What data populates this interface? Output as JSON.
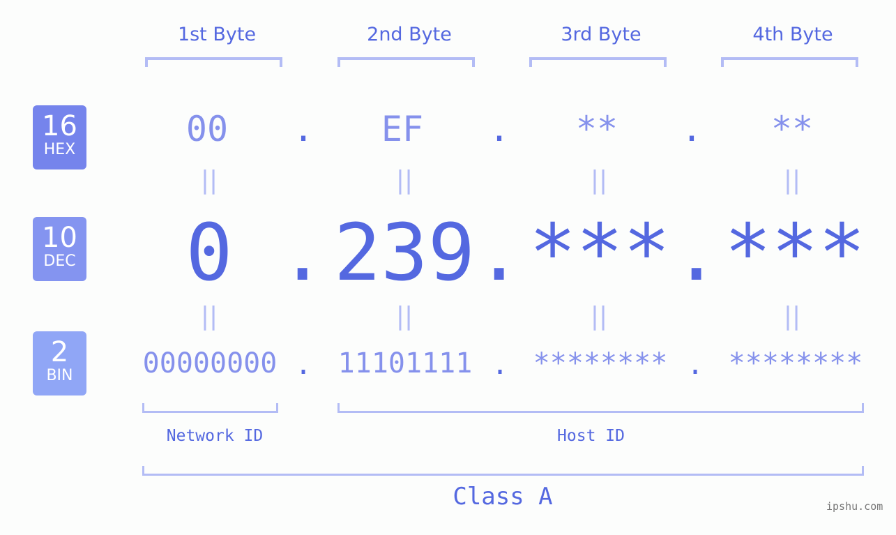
{
  "bytes": [
    "1st Byte",
    "2nd Byte",
    "3rd Byte",
    "4th Byte"
  ],
  "badges": [
    {
      "num": "16",
      "label": "HEX",
      "color": "#7584ec"
    },
    {
      "num": "10",
      "label": "DEC",
      "color": "#8494f0"
    },
    {
      "num": "2",
      "label": "BIN",
      "color": "#90a6f6"
    }
  ],
  "hex": [
    "00",
    "EF",
    "**",
    "**"
  ],
  "dec": [
    "0",
    "239",
    "***",
    "***"
  ],
  "bin": [
    "00000000",
    "11101111",
    "********",
    "********"
  ],
  "separator": ".",
  "equals": "||",
  "network_id_label": "Network ID",
  "host_id_label": "Host ID",
  "class_label": "Class A",
  "watermark": "ipshu.com",
  "colors": {
    "accent": "#5468e0",
    "light": "#8591ec",
    "bracket": "#b3bcf5"
  }
}
